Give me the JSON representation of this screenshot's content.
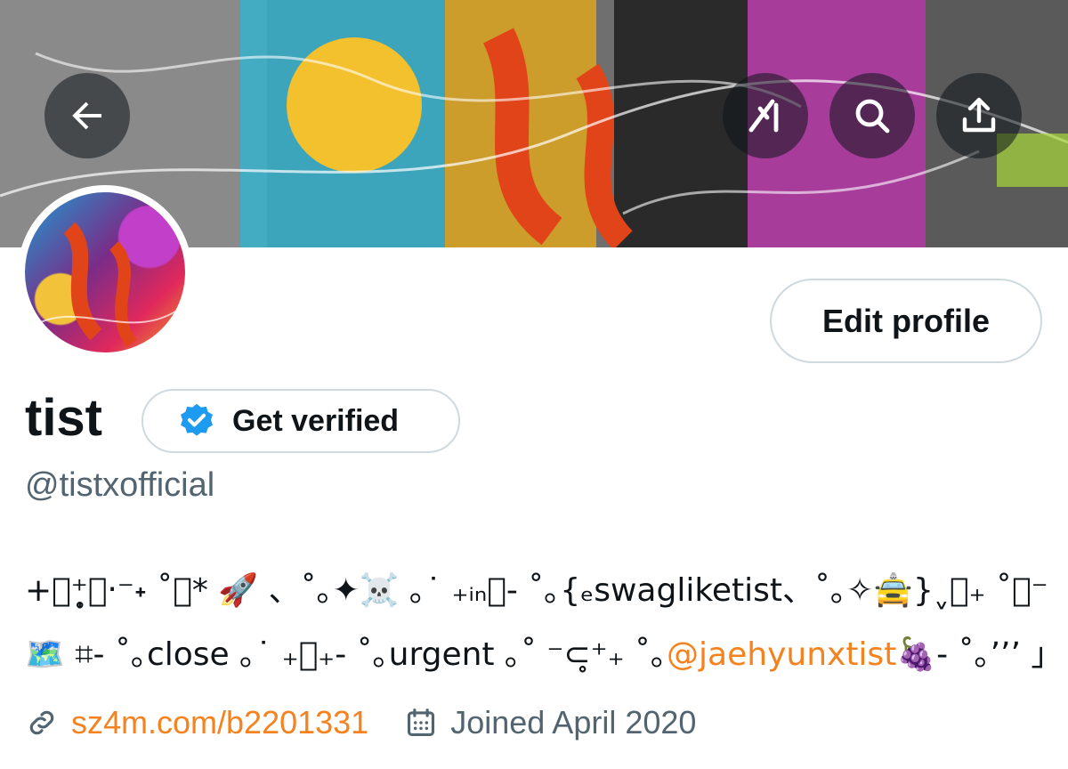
{
  "header": {
    "back_icon": "arrow-left-icon",
    "grok_icon": "grok-icon",
    "search_icon": "search-icon",
    "share_icon": "share-icon"
  },
  "profile": {
    "display_name": "tist",
    "verify_label": "Get verified",
    "verify_icon": "verified-badge-icon",
    "handle": "@tistxofficial",
    "edit_label": "Edit profile"
  },
  "bio": {
    "line1": "+⃞⁺̥̩͙‧⁻˖ ˚｡* 🚀 、˚｡✦☠️ ｡˙ ₊ᵢₙ⃞- ˚｡{ₑswagliketist、˚｡✧🚖}ˬ⃞₊ ˚｡⁻",
    "line2_pre": "🗺️ ⌗- ˚｡close ｡˙ ₊⃞₊- ˚｡urgent ｡˚ ⁻⊂̥⁺₊ ˚｡",
    "mention": "@jaehyunxtist",
    "line2_post": "🍇- ˚｡ʼʼʼ 」"
  },
  "meta": {
    "link_icon": "link-icon",
    "link_text": "sz4m.com/b2201331",
    "calendar_icon": "calendar-icon",
    "joined_text": "Joined April 2020"
  },
  "colors": {
    "accent": "#f4821f",
    "secondary_text": "#536471",
    "verified_blue": "#1d9bf0",
    "border": "#cfd9de"
  }
}
